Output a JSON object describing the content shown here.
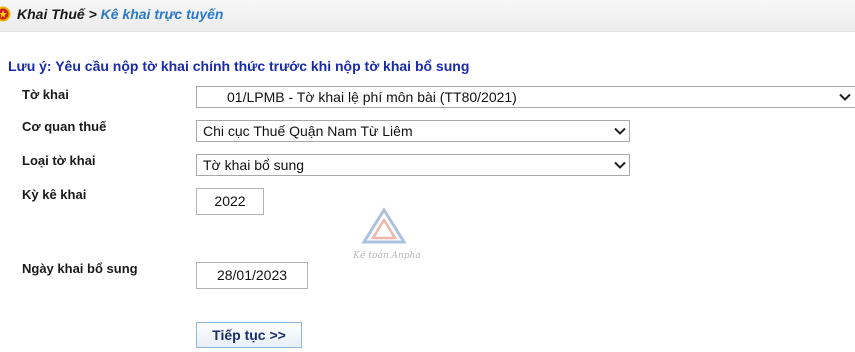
{
  "breadcrumb": {
    "root": "Khai Thuế",
    "separator": ">",
    "current": "Kê khai trực tuyến"
  },
  "notice": "Lưu ý: Yêu cầu nộp tờ khai chính thức trước khi nộp tờ khai bổ sung",
  "form": {
    "to_khai": {
      "label": "Tờ khai",
      "value": "01/LPMB - Tờ khai lệ phí môn bài (TT80/2021)"
    },
    "co_quan_thue": {
      "label": "Cơ quan thuế",
      "value": "Chi cục Thuế Quận Nam Từ Liêm"
    },
    "loai_to_khai": {
      "label": "Loại tờ khai",
      "value": "Tờ khai bổ sung"
    },
    "ky_ke_khai": {
      "label": "Kỳ kê khai",
      "value": "2022"
    },
    "ngay_khai_bo_sung": {
      "label": "Ngày khai bổ sung",
      "value": "28/01/2023"
    }
  },
  "continue_button": "Tiếp tục >>",
  "watermark": {
    "text": "Kế toán Anpha",
    "icon": "anpha-logo-icon"
  },
  "colors": {
    "notice": "#1a2ba8",
    "breadcrumb_current": "#2a78c8",
    "button_text": "#1a2e6e"
  }
}
